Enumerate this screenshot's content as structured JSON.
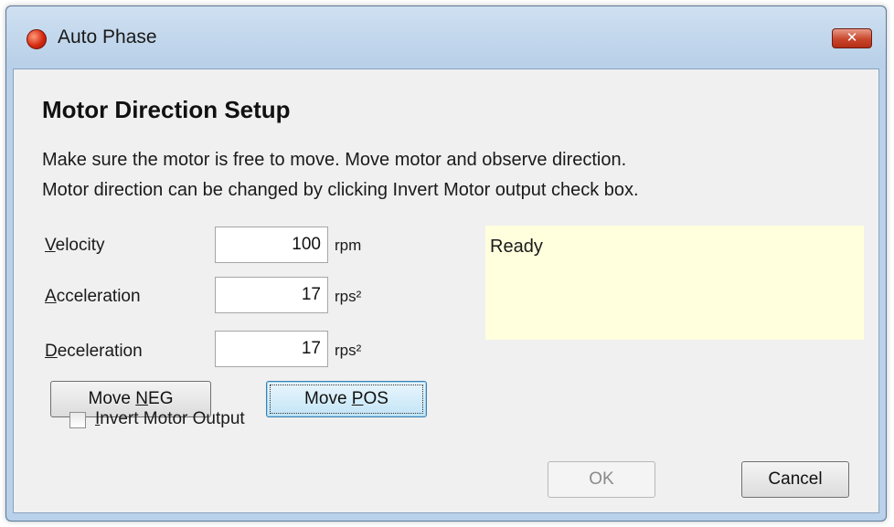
{
  "window": {
    "title": "Auto Phase",
    "close_glyph": "✕"
  },
  "heading": "Motor Direction Setup",
  "description": {
    "line1": "Make sure the motor is free to move.  Move motor and observe direction.",
    "line2": "Motor direction can be changed by clicking Invert Motor output check box."
  },
  "fields": {
    "velocity": {
      "label_mnemonic": "V",
      "label_rest": "elocity",
      "value": "100",
      "unit": "rpm"
    },
    "acceleration": {
      "label_mnemonic": "A",
      "label_rest": "cceleration",
      "value": "17",
      "unit": "rps²"
    },
    "deceleration": {
      "label_mnemonic": "D",
      "label_rest": "eceleration",
      "value": "17",
      "unit": "rps²"
    }
  },
  "status": {
    "text": "Ready",
    "background": "#ffffdd"
  },
  "buttons": {
    "move_neg": {
      "prefix": "Move ",
      "mnemonic": "N",
      "rest": "EG"
    },
    "move_pos": {
      "prefix": "Move ",
      "mnemonic": "P",
      "rest": "OS"
    },
    "ok": "OK",
    "cancel": "Cancel"
  },
  "invert": {
    "mnemonic": "I",
    "rest": "nvert Motor Output",
    "checked": false
  },
  "icons": {
    "app": "app-icon",
    "close": "close-icon"
  }
}
